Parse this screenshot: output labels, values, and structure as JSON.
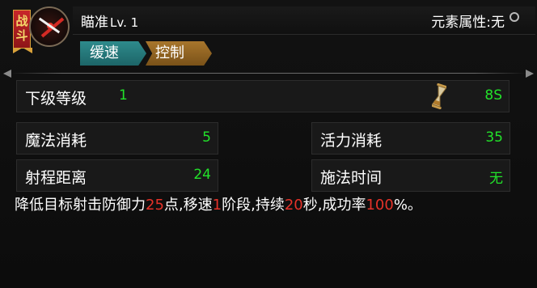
{
  "skill": {
    "badge": "战斗",
    "name": "瞄准",
    "level": "Lv. 1",
    "element_label": "元素属性:无",
    "tags": [
      "缓速",
      "控制"
    ]
  },
  "stats": {
    "next_level": {
      "label": "下级等级",
      "value": "1",
      "cooldown": "8S"
    },
    "mana_cost": {
      "label": "魔法消耗",
      "value": "5"
    },
    "vitality_cost": {
      "label": "活力消耗",
      "value": "35"
    },
    "range": {
      "label": "射程距离",
      "value": "24"
    },
    "cast_time": {
      "label": "施法时间",
      "value": "无"
    }
  },
  "description": {
    "parts": [
      "降低目标射击防御力",
      "25",
      "点,移速",
      "1",
      "阶段,持续",
      "20",
      "秒,成功率",
      "100",
      "%。"
    ]
  },
  "colors": {
    "value_green": "#22e22a",
    "highlight_red": "#e53229",
    "tag_teal": "#2e8b8c",
    "tag_brown": "#a8762c",
    "banner_red": "#c8262a"
  },
  "icons": {
    "skill": "aim-skill-icon",
    "element": "ring-icon",
    "cooldown": "hourglass-icon"
  }
}
